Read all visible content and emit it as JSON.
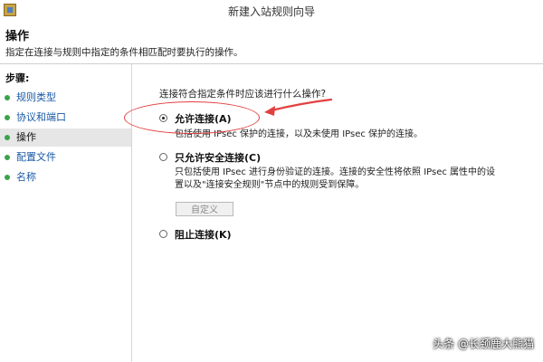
{
  "window": {
    "title": "新建入站规则向导"
  },
  "header": {
    "title": "操作",
    "description": "指定在连接与规则中指定的条件相匹配时要执行的操作。"
  },
  "sidebar": {
    "heading": "步骤:",
    "items": [
      {
        "label": "规则类型",
        "current": false
      },
      {
        "label": "协议和端口",
        "current": false
      },
      {
        "label": "操作",
        "current": true
      },
      {
        "label": "配置文件",
        "current": false
      },
      {
        "label": "名称",
        "current": false
      }
    ]
  },
  "main": {
    "question": "连接符合指定条件时应该进行什么操作?",
    "options": [
      {
        "label": "允许连接(A)",
        "description": "包括使用 IPsec 保护的连接，以及未使用 IPsec 保护的连接。",
        "selected": true
      },
      {
        "label": "只允许安全连接(C)",
        "description_line1": "只包括使用 IPsec 进行身份验证的连接。连接的安全性将依照 IPsec 属性中的设",
        "description_line2": "置以及\"连接安全规则\"节点中的规则受到保障。",
        "selected": false
      },
      {
        "label": "阻止连接(K)",
        "selected": false
      }
    ],
    "customize_button": "自定义"
  },
  "watermark": {
    "text": "头条 @长颈鹿大熊猫"
  },
  "colors": {
    "annotation": "#e24040",
    "step_dot": "#3aa34a",
    "link": "#1a5aa6",
    "current_step_bg": "#e6e6e6"
  }
}
